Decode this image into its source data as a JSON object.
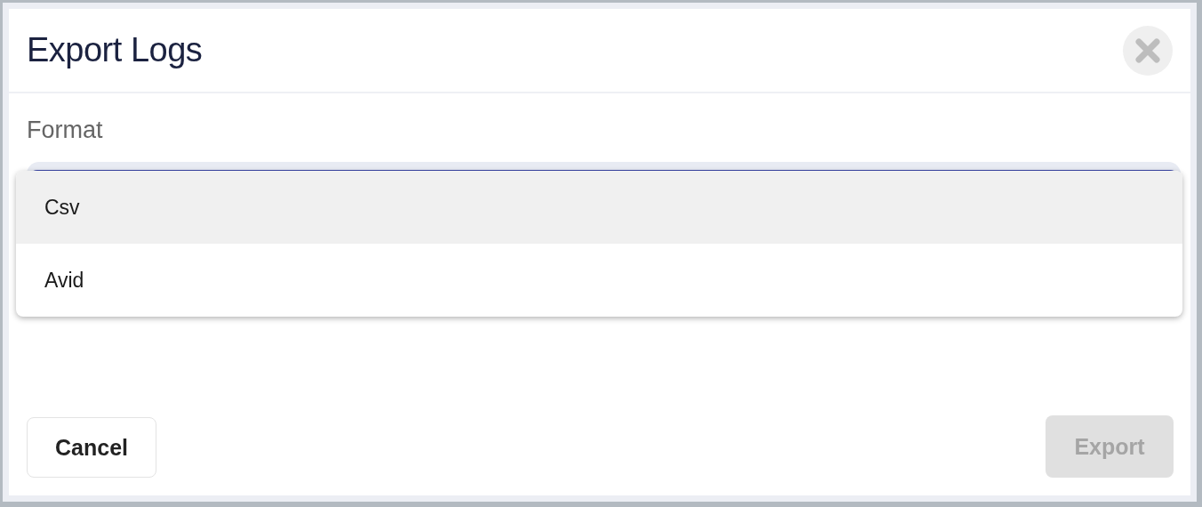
{
  "dialog": {
    "title": "Export Logs"
  },
  "format": {
    "label": "Format",
    "open": true,
    "options": [
      {
        "label": "Csv",
        "highlighted": true
      },
      {
        "label": "Avid",
        "highlighted": false
      }
    ]
  },
  "buttons": [
    {
      "kind": "secondary",
      "label": "Cancel",
      "disabled": false
    },
    {
      "kind": "primary",
      "label": "Export",
      "disabled": true
    }
  ]
}
